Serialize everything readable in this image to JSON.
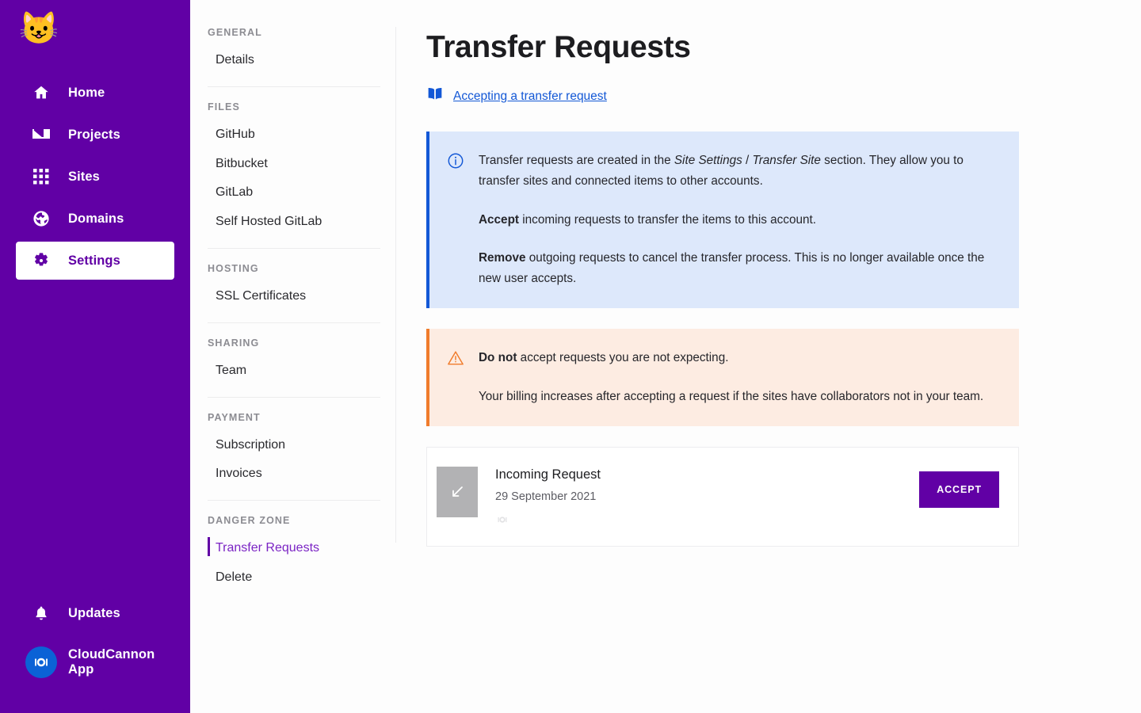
{
  "sidebar": {
    "logo_emoji": "😺",
    "items": [
      {
        "label": "Home",
        "icon": "home-icon"
      },
      {
        "label": "Projects",
        "icon": "projects-icon"
      },
      {
        "label": "Sites",
        "icon": "sites-grid-icon"
      },
      {
        "label": "Domains",
        "icon": "globe-icon"
      },
      {
        "label": "Settings",
        "icon": "gear-icon"
      }
    ],
    "bottom": {
      "updates_label": "Updates",
      "app_label": "CloudCannon App"
    },
    "background_color": "#6100A5",
    "active_item": "Settings"
  },
  "subnav": {
    "groups": [
      {
        "title": "GENERAL",
        "items": [
          {
            "label": "Details"
          }
        ]
      },
      {
        "title": "FILES",
        "items": [
          {
            "label": "GitHub"
          },
          {
            "label": "Bitbucket"
          },
          {
            "label": "GitLab"
          },
          {
            "label": "Self Hosted GitLab"
          }
        ]
      },
      {
        "title": "HOSTING",
        "items": [
          {
            "label": "SSL Certificates"
          }
        ]
      },
      {
        "title": "SHARING",
        "items": [
          {
            "label": "Team"
          }
        ]
      },
      {
        "title": "PAYMENT",
        "items": [
          {
            "label": "Subscription"
          },
          {
            "label": "Invoices"
          }
        ]
      },
      {
        "title": "DANGER ZONE",
        "items": [
          {
            "label": "Transfer Requests",
            "active": true
          },
          {
            "label": "Delete"
          }
        ]
      }
    ],
    "active_item": "Transfer Requests",
    "active_color": "#7B24C4"
  },
  "main": {
    "title": "Transfer Requests",
    "doc_link": {
      "label": "Accepting a transfer request",
      "icon": "book-icon",
      "color": "#1358d6"
    },
    "info_callout": {
      "icon": "info-circle-icon",
      "accent_color": "#1358d6",
      "background_color": "#dde8fb",
      "paragraph1_part1": "Transfer requests are created in the ",
      "paragraph1_em1": "Site Settings",
      "paragraph1_sep": " / ",
      "paragraph1_em2": "Transfer Site",
      "paragraph1_part2": " section. They allow you to transfer sites and connected items to other accounts.",
      "paragraph2_bold": "Accept",
      "paragraph2_rest": " incoming requests to transfer the items to this account.",
      "paragraph3_bold": "Remove",
      "paragraph3_rest": " outgoing requests to cancel the transfer process. This is no longer available once the new user accepts."
    },
    "warning_callout": {
      "icon": "warning-triangle-icon",
      "accent_color": "#f07c2c",
      "background_color": "#fdece2",
      "paragraph1_bold": "Do not",
      "paragraph1_rest": " accept requests you are not expecting.",
      "paragraph2": "Your billing increases after accepting a request if the sites have collaborators not in your team."
    },
    "request_card": {
      "thumbnail_icon": "arrow-down-left-icon",
      "title": "Incoming Request",
      "date": "29 September 2021",
      "mark_icon": "cloudcannon-mark-icon",
      "accept_label": "ACCEPT",
      "accept_color": "#6100A5"
    }
  }
}
